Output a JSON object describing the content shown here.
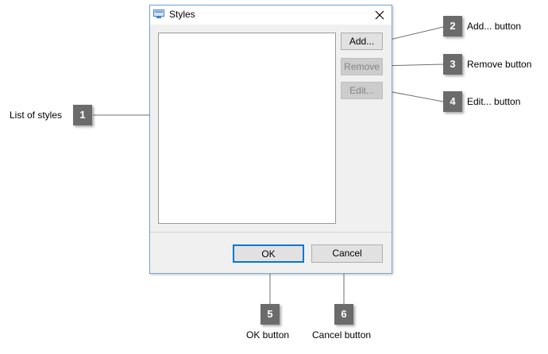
{
  "dialog": {
    "title": "Styles",
    "buttons": {
      "add": "Add...",
      "remove": "Remove",
      "edit": "Edit...",
      "ok": "OK",
      "cancel": "Cancel"
    }
  },
  "callouts": [
    {
      "number": "1",
      "label": "List of styles"
    },
    {
      "number": "2",
      "label": "Add... button"
    },
    {
      "number": "3",
      "label": "Remove button"
    },
    {
      "number": "4",
      "label": "Edit... button"
    },
    {
      "number": "5",
      "label": "OK button"
    },
    {
      "number": "6",
      "label": "Cancel button"
    }
  ],
  "colors": {
    "window_border": "#7aa6d4",
    "default_button_border": "#0078d7",
    "marker_bg": "#6b6b6b"
  },
  "icons": [
    "window-app-icon",
    "close-icon"
  ]
}
